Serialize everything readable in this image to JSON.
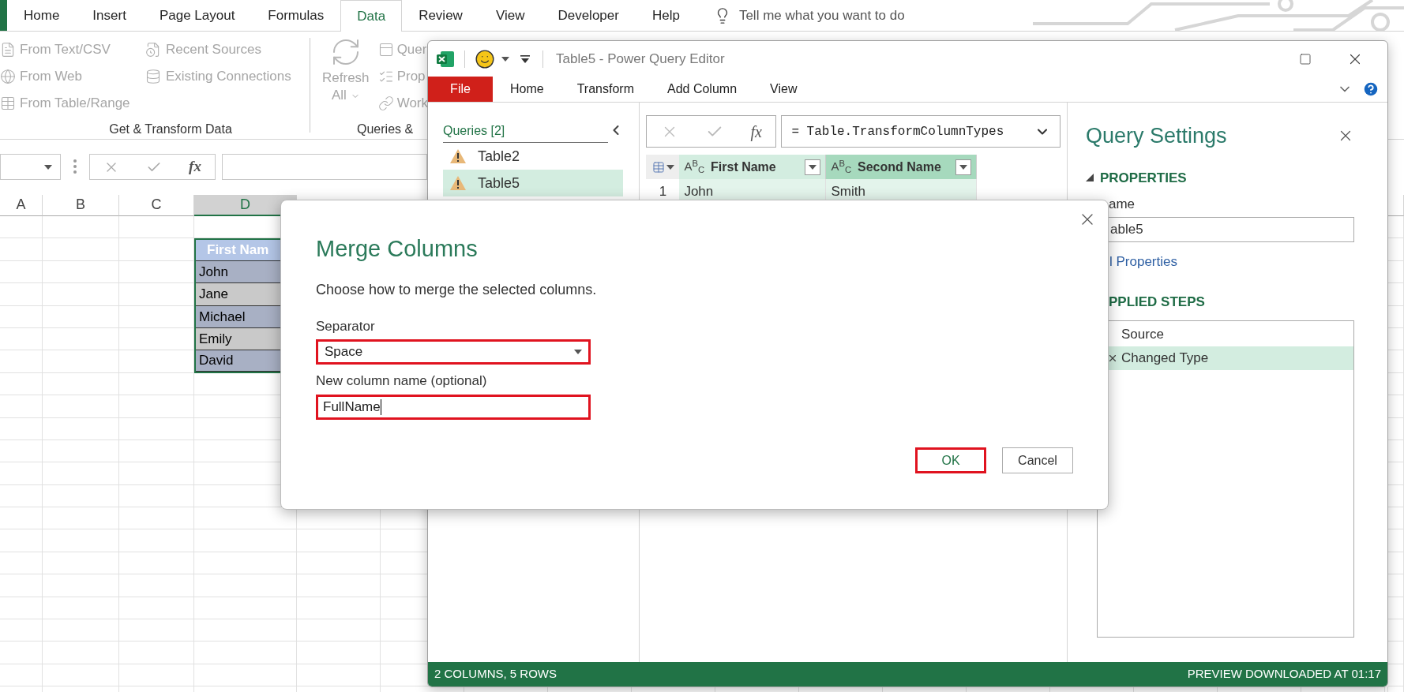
{
  "excel": {
    "ribbon_tabs": [
      {
        "label": "Home",
        "selected": false
      },
      {
        "label": "Insert",
        "selected": false
      },
      {
        "label": "Page Layout",
        "selected": false
      },
      {
        "label": "Formulas",
        "selected": false
      },
      {
        "label": "Data",
        "selected": true
      },
      {
        "label": "Review",
        "selected": false
      },
      {
        "label": "View",
        "selected": false
      },
      {
        "label": "Developer",
        "selected": false
      },
      {
        "label": "Help",
        "selected": false
      }
    ],
    "tell_me": "Tell me what you want to do",
    "get_transform": {
      "label": "Get & Transform Data",
      "items": [
        "From Text/CSV",
        "From Web",
        "From Table/Range",
        "Recent Sources",
        "Existing Connections"
      ]
    },
    "queries_group": {
      "label": "Queries &",
      "refresh": "Refresh All",
      "items": [
        "Quer",
        "Prop",
        "Work"
      ]
    },
    "formula_bar": {
      "fx": "fx"
    },
    "sheet": {
      "columns": [
        {
          "label": "A",
          "selected": false
        },
        {
          "label": "B",
          "selected": false
        },
        {
          "label": "C",
          "selected": false
        },
        {
          "label": "D",
          "selected": true
        }
      ],
      "table": {
        "header": "First Nam",
        "rows": [
          "John",
          "Jane",
          "Michael",
          "Emily",
          "David"
        ]
      }
    }
  },
  "power_query": {
    "title": "Table5 - Power Query Editor",
    "tabs": [
      {
        "label": "File",
        "kind": "file"
      },
      {
        "label": "Home",
        "kind": "tab"
      },
      {
        "label": "Transform",
        "kind": "tab"
      },
      {
        "label": "Add Column",
        "kind": "tab"
      },
      {
        "label": "View",
        "kind": "tab"
      }
    ],
    "queries": {
      "title": "Queries [2]",
      "items": [
        {
          "name": "Table2",
          "selected": false,
          "warning": true
        },
        {
          "name": "Table5",
          "selected": true,
          "warning": true
        }
      ]
    },
    "formula_bar": {
      "fx": "fx",
      "formula": "= Table.TransformColumnTypes"
    },
    "table": {
      "columns": [
        {
          "type": "A$^{B}$$_{C}$",
          "name": "First Name",
          "selected": true,
          "active": false
        },
        {
          "type": "A$^{B}$$_{C}$",
          "name": "Second Name",
          "selected": true,
          "active": true
        }
      ],
      "rows": [
        {
          "number": "1",
          "cells": [
            "John",
            "Smith"
          ]
        }
      ]
    },
    "settings": {
      "title": "Query Settings",
      "properties_heading": "PROPERTIES",
      "name_label": "ame",
      "name_value": "able5",
      "all_properties": "l Properties",
      "steps_heading": "PPLIED STEPS",
      "steps": [
        {
          "name": "Source",
          "selected": false
        },
        {
          "name": "Changed Type",
          "selected": true
        }
      ]
    },
    "status": {
      "left": "2 COLUMNS, 5 ROWS",
      "right": "PREVIEW DOWNLOADED AT 01:17"
    }
  },
  "dialog": {
    "title": "Merge Columns",
    "subtitle": "Choose how to merge the selected columns.",
    "separator": {
      "label": "Separator",
      "value": "Space",
      "highlighted": true
    },
    "new_column": {
      "label": "New column name (optional)",
      "value": "FullName",
      "highlighted": true
    },
    "buttons": [
      {
        "label": "OK",
        "highlighted": true
      },
      {
        "label": "Cancel",
        "highlighted": false
      }
    ]
  }
}
